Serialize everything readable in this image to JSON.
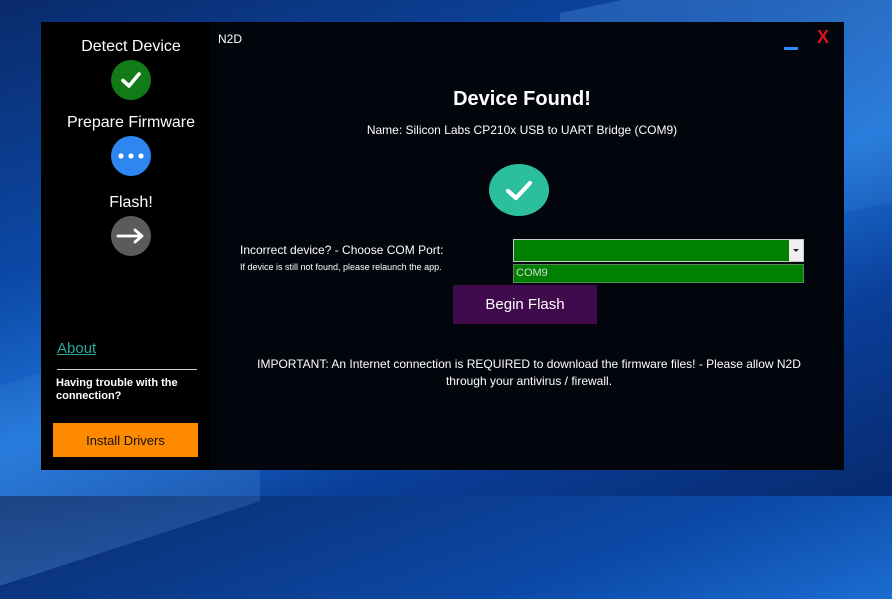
{
  "window": {
    "title": "N2D",
    "minimize_glyph": "minimize-icon",
    "close_glyph": "X"
  },
  "steps": [
    {
      "label": "Detect Device",
      "state": "done",
      "color": "#127a16",
      "icon": "check-icon"
    },
    {
      "label": "Prepare Firmware",
      "state": "in-progress",
      "color": "#2e86f0",
      "icon": "more-dots-icon"
    },
    {
      "label": "Flash!",
      "state": "pending",
      "color": "#5b5b5b",
      "icon": "arrow-right-icon"
    }
  ],
  "sidebar": {
    "about_label": "About",
    "trouble_text": "Having trouble with the connection?",
    "install_drivers_label": "Install Drivers"
  },
  "main": {
    "headline": "Device Found!",
    "device_name": "Name: Silicon Labs CP210x USB to UART Bridge (COM9)",
    "status_icon": "check-circle-icon",
    "com_label": "Incorrect device? - Choose COM Port:",
    "com_hint": "If device is still not found, please relaunch the app.",
    "com_selected": "",
    "com_options": [
      "COM9"
    ],
    "begin_flash_label": "Begin Flash",
    "important_line1": "IMPORTANT: An Internet connection is REQUIRED to download the firmware files! - Please allow N2D",
    "important_line2": "through your antivirus / firewall."
  },
  "colors": {
    "accent_green": "#008000",
    "teal": "#2bbf9e",
    "flash_button": "#3f0b4c",
    "drivers_button": "#ff8a00",
    "close_red": "#e0121b",
    "minimize_blue": "#2e8bff"
  }
}
